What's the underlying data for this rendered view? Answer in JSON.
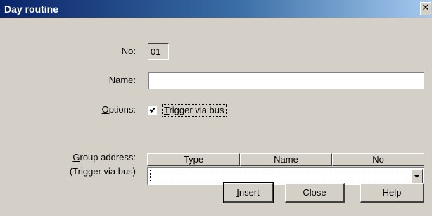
{
  "window": {
    "title": "Day routine",
    "close_glyph": "✕"
  },
  "form": {
    "no_label": "No:",
    "no_value": "01",
    "name_label_pre": "Na",
    "name_label_ul": "m",
    "name_label_post": "e:",
    "name_value": "",
    "options_label_ul": "O",
    "options_label_post": "ptions:",
    "trigger_checked": true,
    "trigger_label_ul": "T",
    "trigger_label_post": "rigger via bus",
    "group_label_ul": "G",
    "group_label_post": "roup address:",
    "group_sub_label": "(Trigger via bus)"
  },
  "grid": {
    "columns": [
      "Type",
      "Name",
      "No"
    ],
    "selected_value": ""
  },
  "buttons": {
    "insert_ul": "I",
    "insert_post": "nsert",
    "close": "Close",
    "help": "Help"
  },
  "icons": {
    "check": "checkmark-icon",
    "dropdown": "chevron-down-icon"
  }
}
